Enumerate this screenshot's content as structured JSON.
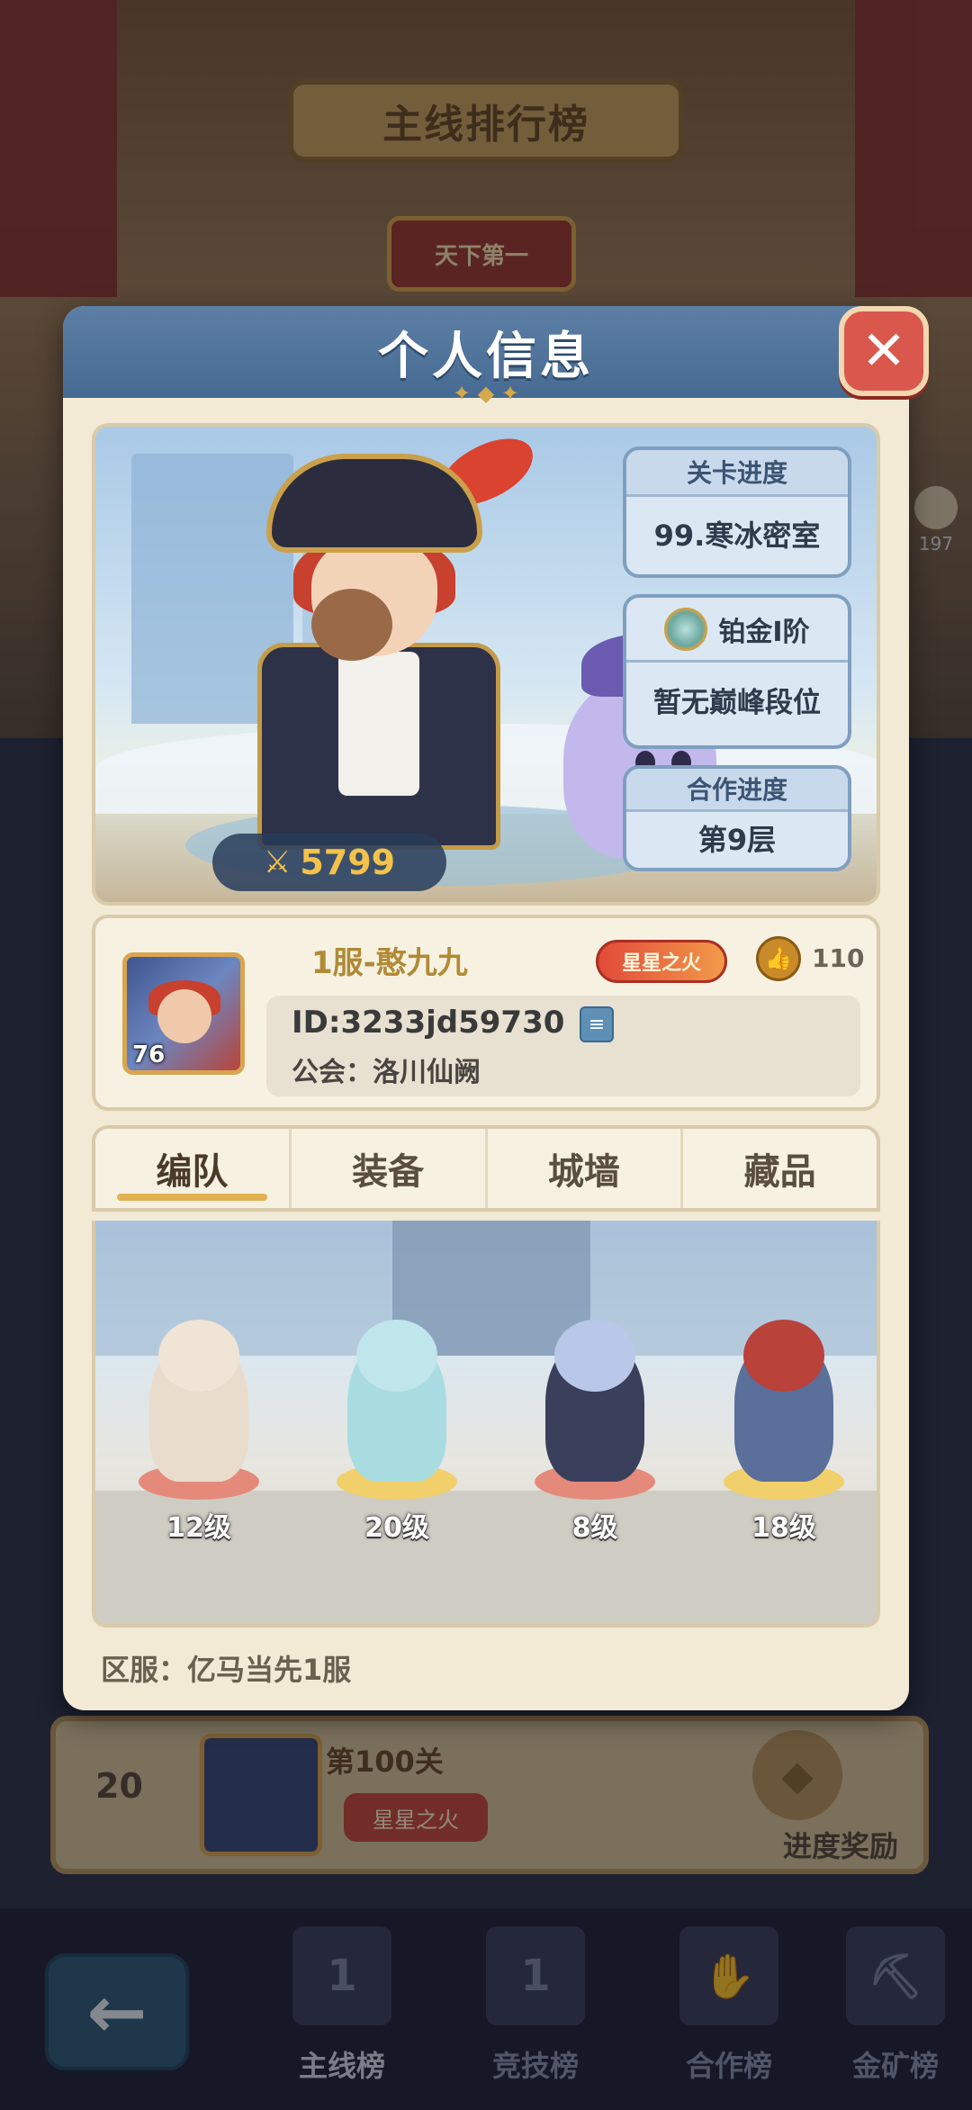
{
  "background": {
    "title": "主线排行榜",
    "rank_badge": "天下第一",
    "side_like_count": "197",
    "row": {
      "rank": "20",
      "stage": "第100关",
      "tag": "星星之火",
      "reward_label": "进度奖励"
    }
  },
  "bottom_nav": {
    "back_icon": "arrow-left-icon",
    "items": [
      {
        "label": "主线榜",
        "icon_text": "1"
      },
      {
        "label": "竞技榜",
        "icon_text": "1"
      },
      {
        "label": "合作榜",
        "icon_text": "✋"
      },
      {
        "label": "金矿榜",
        "icon_text": "⛏"
      }
    ]
  },
  "modal": {
    "title": "个人信息",
    "close_icon": "close-icon",
    "power": "5799",
    "stage_card": {
      "head": "关卡进度",
      "value": "99.寒冰密室"
    },
    "rank_card": {
      "tier": "铂金I阶",
      "peak": "暂无巅峰段位"
    },
    "coop_card": {
      "head": "合作进度",
      "value": "第9层"
    },
    "player": {
      "name": "1服-憨九九",
      "avatar_level": "76",
      "title_badge": "星星之火",
      "likes": "110",
      "id": "ID:3233jd59730",
      "guild": "公会：洛川仙阙"
    },
    "tabs": [
      {
        "label": "编队",
        "active": true
      },
      {
        "label": "装备",
        "active": false
      },
      {
        "label": "城墙",
        "active": false
      },
      {
        "label": "藏品",
        "active": false
      }
    ],
    "team": [
      {
        "level": "12级"
      },
      {
        "level": "20级"
      },
      {
        "level": "8级"
      },
      {
        "level": "18级"
      }
    ],
    "server": "区服：亿马当先1服"
  }
}
